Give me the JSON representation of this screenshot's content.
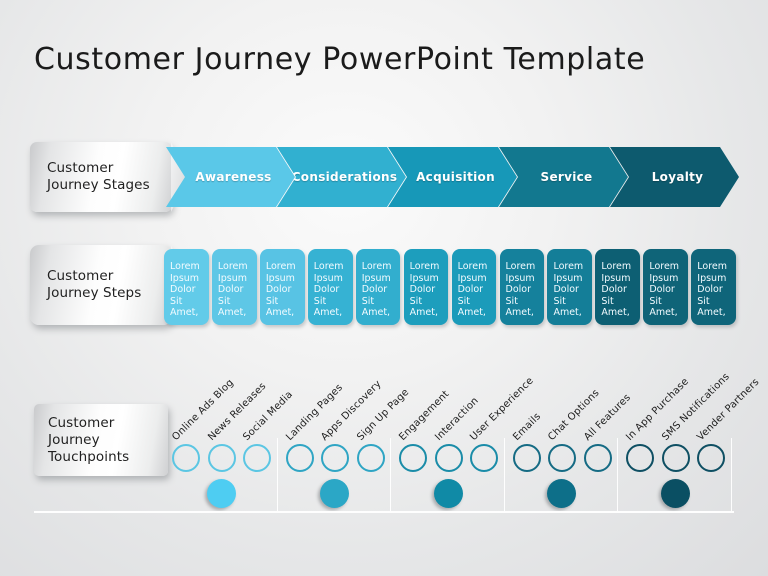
{
  "slide": {
    "title": "Customer Journey PowerPoint Template",
    "background_color": "#e7e8ea"
  },
  "rows": {
    "stages_label": "Customer\nJourney Stages",
    "steps_label": "Customer\nJourney Steps",
    "touchpoints_label": "Customer\nJourney\nTouchpoints"
  },
  "stages": [
    {
      "label": "Awareness",
      "color": "#5ac8e8"
    },
    {
      "label": "Considerations",
      "color": "#31b0d0"
    },
    {
      "label": "Acquisition",
      "color": "#1798b8"
    },
    {
      "label": "Service",
      "color": "#12788f"
    },
    {
      "label": "Loyalty",
      "color": "#0d5a6e"
    }
  ],
  "steps": [
    {
      "text": "Lorem\nIpsum\nDolor Sit\nAmet,",
      "color": "#62cbe9"
    },
    {
      "text": "Lorem\nIpsum\nDolor Sit\nAmet,",
      "color": "#5ec7e6"
    },
    {
      "text": "Lorem\nIpsum\nDolor Sit\nAmet,",
      "color": "#58c3e4"
    },
    {
      "text": "Lorem\nIpsum\nDolor Sit\nAmet,",
      "color": "#36b2d3"
    },
    {
      "text": "Lorem\nIpsum\nDolor Sit\nAmet,",
      "color": "#32aece"
    },
    {
      "text": "Lorem\nIpsum\nDolor Sit\nAmet,",
      "color": "#1d9ebd"
    },
    {
      "text": "Lorem\nIpsum\nDolor Sit\nAmet,",
      "color": "#1b9bba"
    },
    {
      "text": "Lorem\nIpsum\nDolor Sit\nAmet,",
      "color": "#15819c"
    },
    {
      "text": "Lorem\nIpsum\nDolor Sit\nAmet,",
      "color": "#147e98"
    },
    {
      "text": "Lorem\nIpsum\nDolor Sit\nAmet,",
      "color": "#0d5f73"
    },
    {
      "text": "Lorem\nIpsum\nDolor Sit\nAmet,",
      "color": "#0f6478"
    },
    {
      "text": "Lorem\nIpsum\nDolor Sit\nAmet,",
      "color": "#0f657a"
    }
  ],
  "touchpoint_groups": [
    {
      "ring_color": "#5bc6e3",
      "dot_color": "#4ecdf2",
      "labels": [
        "Online Ads Blog",
        "News Releases",
        "Social Media"
      ]
    },
    {
      "ring_color": "#2fa5c4",
      "dot_color": "#2ba7c6",
      "labels": [
        "Landing Pages",
        "Apps Discovery",
        "Sign Up Page"
      ]
    },
    {
      "ring_color": "#1a8ca8",
      "dot_color": "#108aa6",
      "labels": [
        "Engagement",
        "Interaction",
        "User Experience"
      ]
    },
    {
      "ring_color": "#156b84",
      "dot_color": "#0d6f89",
      "labels": [
        "Emails",
        "Chat Options",
        "All Features"
      ]
    },
    {
      "ring_color": "#0e4f63",
      "dot_color": "#0a4f63",
      "labels": [
        "In App Purchase",
        "SMS Notifications",
        "Vender Partners"
      ]
    }
  ]
}
